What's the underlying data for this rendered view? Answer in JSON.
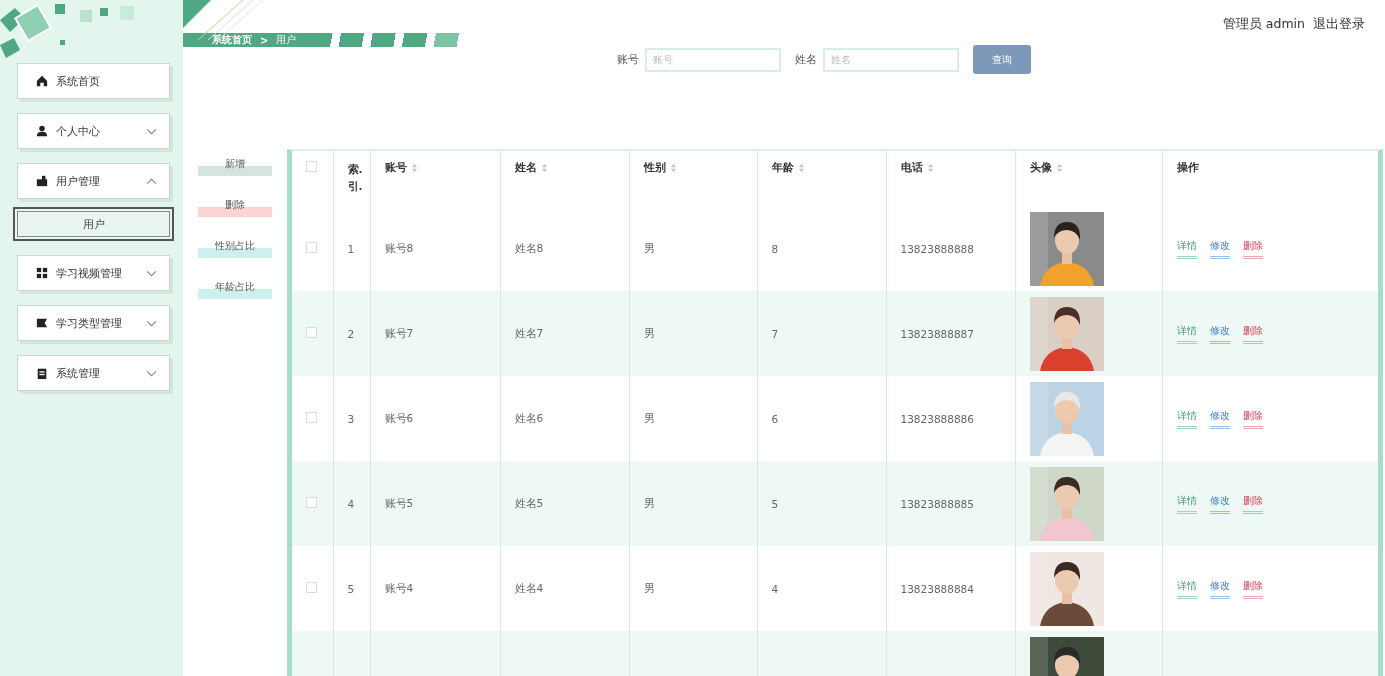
{
  "header": {
    "user": "管理员 admin",
    "logout": "退出登录"
  },
  "breadcrumb": {
    "home": "系统首页",
    "separator": ">",
    "current": "用户"
  },
  "sidebar": {
    "items": [
      {
        "label": "系统首页",
        "kind": "home"
      },
      {
        "label": "个人中心",
        "kind": "user",
        "expanded": false
      },
      {
        "label": "用户管理",
        "kind": "briefcase",
        "expanded": true,
        "children": [
          {
            "label": "用户",
            "selected": true
          }
        ]
      },
      {
        "label": "学习视频管理",
        "kind": "grid",
        "expanded": false
      },
      {
        "label": "学习类型管理",
        "kind": "film",
        "expanded": false
      },
      {
        "label": "系统管理",
        "kind": "clipboard",
        "expanded": false
      }
    ]
  },
  "search": {
    "fields": [
      {
        "label": "账号",
        "placeholder": "账号"
      },
      {
        "label": "姓名",
        "placeholder": "姓名"
      }
    ],
    "button": "查询"
  },
  "actions": [
    {
      "label": "新增",
      "kind": "add"
    },
    {
      "label": "删除",
      "kind": "delete"
    },
    {
      "label": "性别占比",
      "kind": "chart"
    },
    {
      "label": "年龄占比",
      "kind": "chart"
    }
  ],
  "table": {
    "select_all": false,
    "columns": [
      {
        "label": "索.引.",
        "sortable": false
      },
      {
        "label": "账号",
        "sortable": true
      },
      {
        "label": "姓名",
        "sortable": true
      },
      {
        "label": "性别",
        "sortable": true
      },
      {
        "label": "年龄",
        "sortable": true
      },
      {
        "label": "电话",
        "sortable": true
      },
      {
        "label": "头像",
        "sortable": true
      },
      {
        "label": "操作",
        "sortable": false
      }
    ],
    "rows": [
      {
        "checked": false,
        "index": "1",
        "account": "账号8",
        "name": "姓名8",
        "gender": "男",
        "age": "8",
        "phone": "13823888888",
        "avatar": {
          "kind": "picture"
        },
        "actions": [
          {
            "label": "详情",
            "kind": "detail"
          },
          {
            "label": "修改",
            "kind": "edit"
          },
          {
            "label": "删除",
            "kind": "delete"
          }
        ]
      },
      {
        "checked": false,
        "index": "2",
        "account": "账号7",
        "name": "姓名7",
        "gender": "男",
        "age": "7",
        "phone": "13823888887",
        "avatar": {
          "kind": "picture"
        },
        "actions": [
          {
            "label": "详情",
            "kind": "detail"
          },
          {
            "label": "修改",
            "kind": "edit"
          },
          {
            "label": "删除",
            "kind": "delete"
          }
        ]
      },
      {
        "checked": false,
        "index": "3",
        "account": "账号6",
        "name": "姓名6",
        "gender": "男",
        "age": "6",
        "phone": "13823888886",
        "avatar": {
          "kind": "picture"
        },
        "actions": [
          {
            "label": "详情",
            "kind": "detail"
          },
          {
            "label": "修改",
            "kind": "edit"
          },
          {
            "label": "删除",
            "kind": "delete"
          }
        ]
      },
      {
        "checked": false,
        "index": "4",
        "account": "账号5",
        "name": "姓名5",
        "gender": "男",
        "age": "5",
        "phone": "13823888885",
        "avatar": {
          "kind": "picture"
        },
        "actions": [
          {
            "label": "详情",
            "kind": "detail"
          },
          {
            "label": "修改",
            "kind": "edit"
          },
          {
            "label": "删除",
            "kind": "delete"
          }
        ]
      },
      {
        "checked": false,
        "index": "5",
        "account": "账号4",
        "name": "姓名4",
        "gender": "男",
        "age": "4",
        "phone": "13823888884",
        "avatar": {
          "kind": "picture"
        },
        "actions": [
          {
            "label": "详情",
            "kind": "detail"
          },
          {
            "label": "修改",
            "kind": "edit"
          },
          {
            "label": "删除",
            "kind": "delete"
          }
        ]
      },
      {
        "avatar": {
          "kind": "picture"
        }
      }
    ]
  }
}
